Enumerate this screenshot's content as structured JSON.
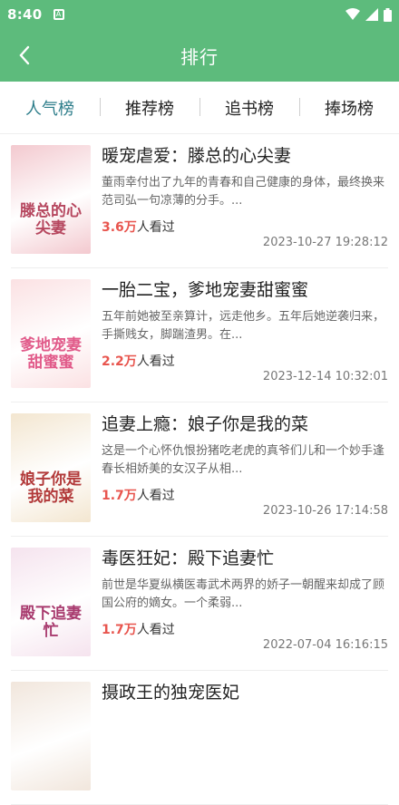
{
  "status_bar": {
    "time": "8:40"
  },
  "app_bar": {
    "title": "排行"
  },
  "tabs": [
    {
      "label": "人气榜",
      "active": true
    },
    {
      "label": "推荐榜",
      "active": false
    },
    {
      "label": "追书榜",
      "active": false
    },
    {
      "label": "捧场榜",
      "active": false
    }
  ],
  "books": [
    {
      "title": "暖宠虐爱：滕总的心尖妻",
      "cover_text": "滕总的心尖妻",
      "description": "董雨幸付出了九年的青春和自己健康的身体，最终换来范司弘一句凉薄的分手。...",
      "read_count": "3.6万",
      "read_suffix": "人看过",
      "updated": "2023-10-27 19:28:12",
      "cover_colors": [
        "#f3c9cf",
        "#b6475f"
      ]
    },
    {
      "title": "一胎二宝，爹地宠妻甜蜜蜜",
      "cover_text": "爹地宠妻甜蜜蜜",
      "description": "五年前她被至亲算计，远走他乡。五年后她逆袭归来，手撕贱女，脚踹渣男。在...",
      "read_count": "2.2万",
      "read_suffix": "人看过",
      "updated": "2023-12-14 10:32:01",
      "cover_colors": [
        "#fbe1e3",
        "#e15b8a"
      ]
    },
    {
      "title": "追妻上瘾：娘子你是我的菜",
      "cover_text": "娘子你是我的菜",
      "description": "这是一个心怀仇恨扮猪吃老虎的真爷们儿和一个妙手逢春长相娇美的女汉子从相...",
      "read_count": "1.7万",
      "read_suffix": "人看过",
      "updated": "2023-10-26 17:14:58",
      "cover_colors": [
        "#f3e6d0",
        "#b23a3a"
      ]
    },
    {
      "title": "毒医狂妃：殿下追妻忙",
      "cover_text": "殿下追妻忙",
      "description": "前世是华夏纵横医毒武术两界的娇子一朝醒来却成了顾国公府的嫡女。一个柔弱...",
      "read_count": "1.7万",
      "read_suffix": "人看过",
      "updated": "2022-07-04 16:16:15",
      "cover_colors": [
        "#f5e3ee",
        "#a83a6e"
      ]
    },
    {
      "title": "摄政王的独宠医妃",
      "cover_text": "",
      "description": "",
      "read_count": "",
      "read_suffix": "",
      "updated": "",
      "cover_colors": [
        "#f1e6dc",
        "#c46b4e"
      ]
    }
  ]
}
